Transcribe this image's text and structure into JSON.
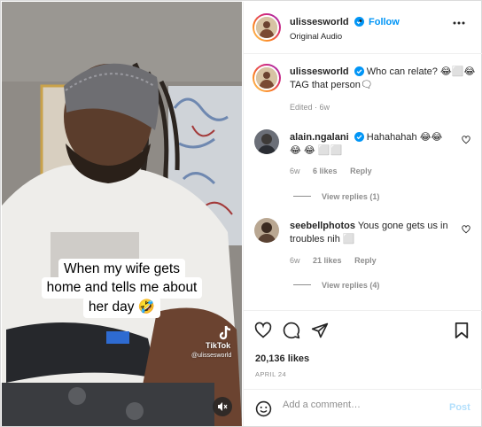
{
  "colors": {
    "accent": "#0095f6",
    "muted": "#8e8e8e",
    "text": "#262626",
    "post_disabled": "#b2dffc"
  },
  "video": {
    "caption_lines": [
      "When my wife gets",
      "home and tells me about",
      "her day 🤣"
    ],
    "watermark_name": "TikTok",
    "watermark_user": "@ulissesworld",
    "mute_icon": "speaker-muted-icon"
  },
  "header": {
    "username": "ulissesworld",
    "separator": "•",
    "follow_label": "Follow",
    "subtitle": "Original Audio",
    "more_icon": "more-options-icon"
  },
  "caption_post": {
    "username": "ulissesworld",
    "text": "Who can relate? 😂⬜😂 TAG that person🗨",
    "edited": "Edited · 6w"
  },
  "comments": [
    {
      "username": "alain.ngalani",
      "text": "Hahahahah 😂😂😂 😂 ⬜⬜",
      "age": "6w",
      "likes": "6 likes",
      "reply_label": "Reply",
      "view_replies": "View replies (1)"
    },
    {
      "username": "seebellphotos",
      "text": "Yous gone gets us in troubles nih ⬜",
      "age": "6w",
      "likes": "21 likes",
      "reply_label": "Reply",
      "view_replies": "View replies (4)"
    }
  ],
  "actions": {
    "likes": "20,136 likes",
    "date": "APRIL 24"
  },
  "add_comment": {
    "placeholder": "Add a comment…",
    "post_label": "Post"
  }
}
